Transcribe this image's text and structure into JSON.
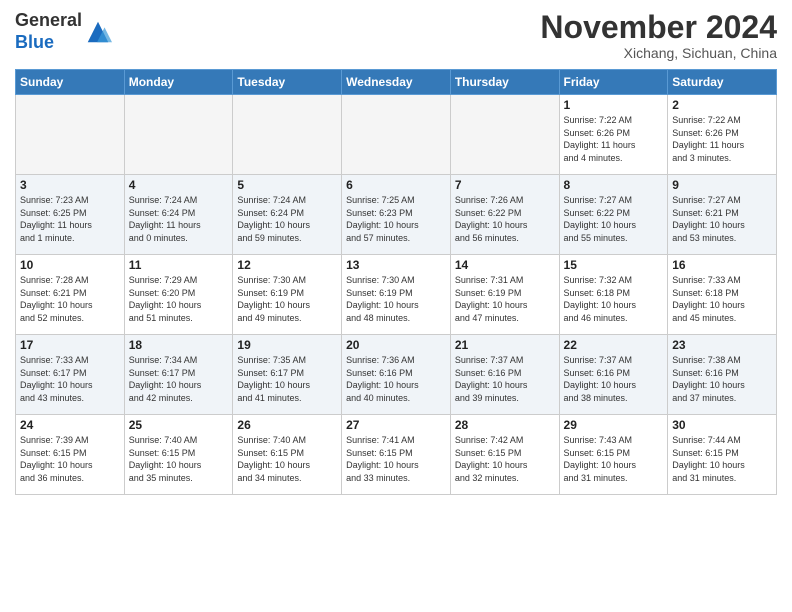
{
  "logo": {
    "general": "General",
    "blue": "Blue"
  },
  "title": "November 2024",
  "location": "Xichang, Sichuan, China",
  "days_of_week": [
    "Sunday",
    "Monday",
    "Tuesday",
    "Wednesday",
    "Thursday",
    "Friday",
    "Saturday"
  ],
  "weeks": [
    [
      {
        "day": "",
        "info": "",
        "empty": true
      },
      {
        "day": "",
        "info": "",
        "empty": true
      },
      {
        "day": "",
        "info": "",
        "empty": true
      },
      {
        "day": "",
        "info": "",
        "empty": true
      },
      {
        "day": "",
        "info": "",
        "empty": true
      },
      {
        "day": "1",
        "info": "Sunrise: 7:22 AM\nSunset: 6:26 PM\nDaylight: 11 hours\nand 4 minutes."
      },
      {
        "day": "2",
        "info": "Sunrise: 7:22 AM\nSunset: 6:26 PM\nDaylight: 11 hours\nand 3 minutes."
      }
    ],
    [
      {
        "day": "3",
        "info": "Sunrise: 7:23 AM\nSunset: 6:25 PM\nDaylight: 11 hours\nand 1 minute."
      },
      {
        "day": "4",
        "info": "Sunrise: 7:24 AM\nSunset: 6:24 PM\nDaylight: 11 hours\nand 0 minutes."
      },
      {
        "day": "5",
        "info": "Sunrise: 7:24 AM\nSunset: 6:24 PM\nDaylight: 10 hours\nand 59 minutes."
      },
      {
        "day": "6",
        "info": "Sunrise: 7:25 AM\nSunset: 6:23 PM\nDaylight: 10 hours\nand 57 minutes."
      },
      {
        "day": "7",
        "info": "Sunrise: 7:26 AM\nSunset: 6:22 PM\nDaylight: 10 hours\nand 56 minutes."
      },
      {
        "day": "8",
        "info": "Sunrise: 7:27 AM\nSunset: 6:22 PM\nDaylight: 10 hours\nand 55 minutes."
      },
      {
        "day": "9",
        "info": "Sunrise: 7:27 AM\nSunset: 6:21 PM\nDaylight: 10 hours\nand 53 minutes."
      }
    ],
    [
      {
        "day": "10",
        "info": "Sunrise: 7:28 AM\nSunset: 6:21 PM\nDaylight: 10 hours\nand 52 minutes."
      },
      {
        "day": "11",
        "info": "Sunrise: 7:29 AM\nSunset: 6:20 PM\nDaylight: 10 hours\nand 51 minutes."
      },
      {
        "day": "12",
        "info": "Sunrise: 7:30 AM\nSunset: 6:19 PM\nDaylight: 10 hours\nand 49 minutes."
      },
      {
        "day": "13",
        "info": "Sunrise: 7:30 AM\nSunset: 6:19 PM\nDaylight: 10 hours\nand 48 minutes."
      },
      {
        "day": "14",
        "info": "Sunrise: 7:31 AM\nSunset: 6:19 PM\nDaylight: 10 hours\nand 47 minutes."
      },
      {
        "day": "15",
        "info": "Sunrise: 7:32 AM\nSunset: 6:18 PM\nDaylight: 10 hours\nand 46 minutes."
      },
      {
        "day": "16",
        "info": "Sunrise: 7:33 AM\nSunset: 6:18 PM\nDaylight: 10 hours\nand 45 minutes."
      }
    ],
    [
      {
        "day": "17",
        "info": "Sunrise: 7:33 AM\nSunset: 6:17 PM\nDaylight: 10 hours\nand 43 minutes."
      },
      {
        "day": "18",
        "info": "Sunrise: 7:34 AM\nSunset: 6:17 PM\nDaylight: 10 hours\nand 42 minutes."
      },
      {
        "day": "19",
        "info": "Sunrise: 7:35 AM\nSunset: 6:17 PM\nDaylight: 10 hours\nand 41 minutes."
      },
      {
        "day": "20",
        "info": "Sunrise: 7:36 AM\nSunset: 6:16 PM\nDaylight: 10 hours\nand 40 minutes."
      },
      {
        "day": "21",
        "info": "Sunrise: 7:37 AM\nSunset: 6:16 PM\nDaylight: 10 hours\nand 39 minutes."
      },
      {
        "day": "22",
        "info": "Sunrise: 7:37 AM\nSunset: 6:16 PM\nDaylight: 10 hours\nand 38 minutes."
      },
      {
        "day": "23",
        "info": "Sunrise: 7:38 AM\nSunset: 6:16 PM\nDaylight: 10 hours\nand 37 minutes."
      }
    ],
    [
      {
        "day": "24",
        "info": "Sunrise: 7:39 AM\nSunset: 6:15 PM\nDaylight: 10 hours\nand 36 minutes."
      },
      {
        "day": "25",
        "info": "Sunrise: 7:40 AM\nSunset: 6:15 PM\nDaylight: 10 hours\nand 35 minutes."
      },
      {
        "day": "26",
        "info": "Sunrise: 7:40 AM\nSunset: 6:15 PM\nDaylight: 10 hours\nand 34 minutes."
      },
      {
        "day": "27",
        "info": "Sunrise: 7:41 AM\nSunset: 6:15 PM\nDaylight: 10 hours\nand 33 minutes."
      },
      {
        "day": "28",
        "info": "Sunrise: 7:42 AM\nSunset: 6:15 PM\nDaylight: 10 hours\nand 32 minutes."
      },
      {
        "day": "29",
        "info": "Sunrise: 7:43 AM\nSunset: 6:15 PM\nDaylight: 10 hours\nand 31 minutes."
      },
      {
        "day": "30",
        "info": "Sunrise: 7:44 AM\nSunset: 6:15 PM\nDaylight: 10 hours\nand 31 minutes."
      }
    ]
  ]
}
